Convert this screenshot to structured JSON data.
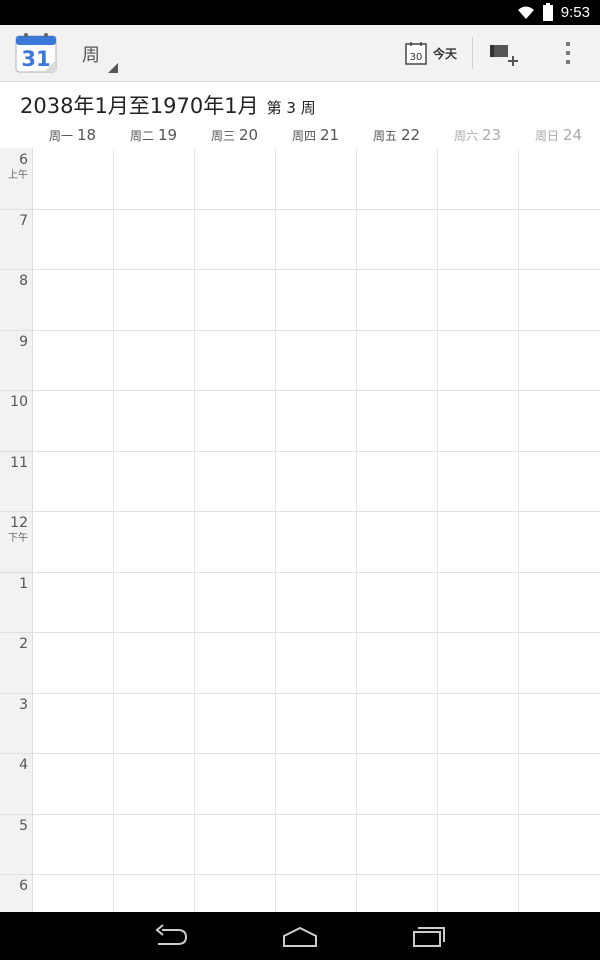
{
  "status_bar": {
    "time": "9:53"
  },
  "action_bar": {
    "app_icon_day": "31",
    "view_label": "周",
    "today_icon_day": "30",
    "today_label": "今天"
  },
  "date_header": {
    "range": "2038年1月至1970年1月",
    "week_number": "第 3 周"
  },
  "days": [
    {
      "weekday": "周一",
      "date": "18",
      "weekend": false
    },
    {
      "weekday": "周二",
      "date": "19",
      "weekend": false
    },
    {
      "weekday": "周三",
      "date": "20",
      "weekend": false
    },
    {
      "weekday": "周四",
      "date": "21",
      "weekend": false
    },
    {
      "weekday": "周五",
      "date": "22",
      "weekend": false
    },
    {
      "weekday": "周六",
      "date": "23",
      "weekend": true
    },
    {
      "weekday": "周日",
      "date": "24",
      "weekend": true
    }
  ],
  "hours": [
    {
      "label": "6",
      "ampm": "上午"
    },
    {
      "label": "7",
      "ampm": ""
    },
    {
      "label": "8",
      "ampm": ""
    },
    {
      "label": "9",
      "ampm": ""
    },
    {
      "label": "10",
      "ampm": ""
    },
    {
      "label": "11",
      "ampm": ""
    },
    {
      "label": "12",
      "ampm": "下午"
    },
    {
      "label": "1",
      "ampm": ""
    },
    {
      "label": "2",
      "ampm": ""
    },
    {
      "label": "3",
      "ampm": ""
    },
    {
      "label": "4",
      "ampm": ""
    },
    {
      "label": "5",
      "ampm": ""
    },
    {
      "label": "6",
      "ampm": ""
    }
  ],
  "icons": {
    "wifi": "wifi-icon",
    "battery": "battery-icon",
    "calendar": "calendar-app-icon",
    "today": "today-calendar-icon",
    "new_event": "new-event-icon",
    "overflow": "overflow-menu-icon",
    "back": "back-icon",
    "home": "home-icon",
    "recents": "recent-apps-icon"
  },
  "colors": {
    "action_bar_bg": "#f2f2f2",
    "calendar_blue": "#3b78d8",
    "grid_line": "#e0e0e0",
    "weekend_text": "#aaaaaa"
  }
}
